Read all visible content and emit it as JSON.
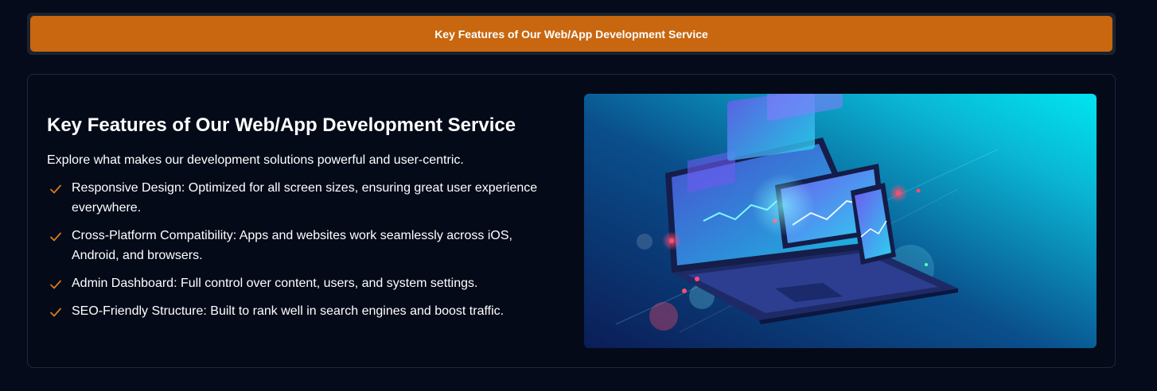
{
  "tabs": {
    "active_label": "Key Features of Our Web/App Development Service"
  },
  "section": {
    "heading": "Key Features of Our Web/App Development Service",
    "subtitle": "Explore what makes our development solutions powerful and user-centric.",
    "features": [
      "Responsive Design: Optimized for all screen sizes, ensuring great user experience everywhere.",
      "Cross-Platform Compatibility: Apps and websites work seamlessly across iOS, Android, and browsers.",
      "Admin Dashboard: Full control over content, users, and system settings.",
      "SEO-Friendly Structure: Built to rank well in search engines and boost traffic."
    ],
    "check_icon": "checkmark-icon"
  },
  "image": {
    "subject": "laptop-tablet-phone-illustration"
  },
  "colors": {
    "background": "#050b1a",
    "accent": "#c8670f",
    "check": "#d9791f",
    "image_gradient_start": "#0b1d57",
    "image_gradient_end": "#00e5f0"
  }
}
